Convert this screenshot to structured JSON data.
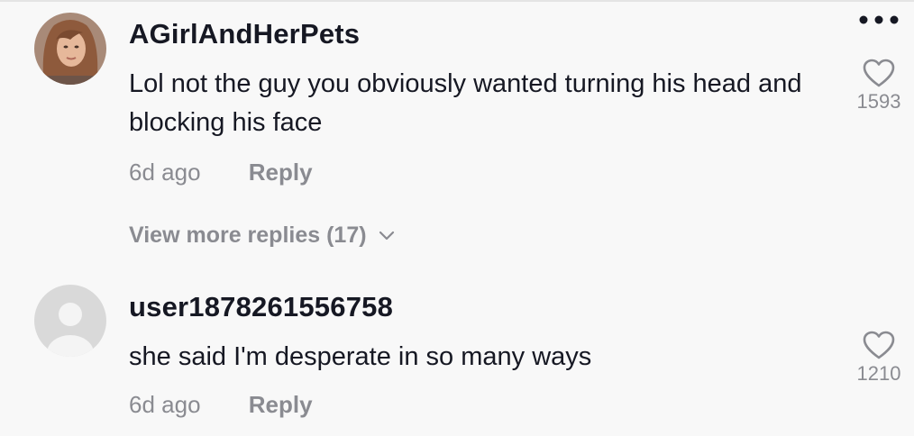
{
  "comments": [
    {
      "username": "AGirlAndHerPets",
      "text": "Lol not the guy you obviously wanted turning his head and blocking his face",
      "time": "6d ago",
      "reply_label": "Reply",
      "likes": "1593",
      "avatar": "profile-photo"
    },
    {
      "username": "user1878261556758",
      "text": "she said I'm desperate in so many ways",
      "time": "6d ago",
      "reply_label": "Reply",
      "likes": "1210",
      "avatar": "default-avatar"
    }
  ],
  "view_more_label": "View more replies (17)",
  "icons": {
    "more": "more-options-icon",
    "like": "heart-icon",
    "expand": "chevron-down-icon"
  },
  "colors": {
    "background": "#f8f8f8",
    "primary_text": "#161823",
    "secondary_text": "#8a8b91"
  }
}
